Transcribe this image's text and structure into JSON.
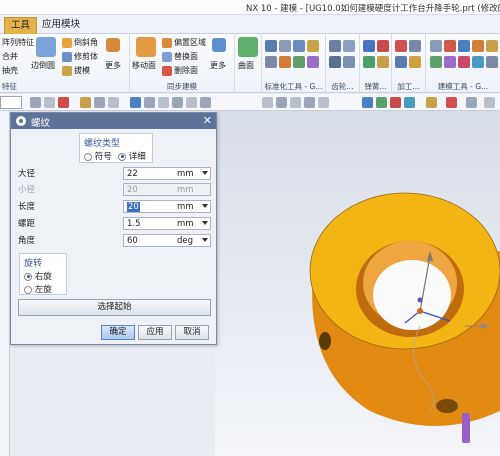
{
  "window": {
    "title": "NX 10 - 建模 - [UG10.0如何建模硬度计工作台升降手轮.prt  (修改的) ]"
  },
  "ribbon": {
    "tabs": [
      "工具",
      "应用模块"
    ],
    "groups": [
      {
        "label": "特征",
        "items": [
          "阵列特征",
          "合并",
          "抽壳",
          "边倒圆",
          "倒斜角",
          "修剪体",
          "拔模",
          "更多"
        ]
      },
      {
        "label": "同步建模",
        "items": [
          "移动面",
          "偏置区域",
          "替换面",
          "删除面",
          "更多"
        ]
      },
      {
        "label": "曲面",
        "items": [
          "曲面"
        ]
      },
      {
        "label": "标准化工具 - G...",
        "items": []
      },
      {
        "label": "齿轮...",
        "items": []
      },
      {
        "label": "弹簧...",
        "items": []
      },
      {
        "label": "加工...",
        "items": []
      },
      {
        "label": "建模工具 - G...",
        "items": []
      }
    ]
  },
  "dialog": {
    "title": "螺纹",
    "thread_type": {
      "header": "螺纹类型",
      "options": [
        "符号",
        "详细"
      ],
      "selected": "详细"
    },
    "fields": [
      {
        "label": "大径",
        "value": "22",
        "unit": "mm",
        "enabled": true
      },
      {
        "label": "小径",
        "value": "20",
        "unit": "mm",
        "enabled": false
      },
      {
        "label": "长度",
        "value": "20",
        "unit": "mm",
        "enabled": true
      },
      {
        "label": "螺距",
        "value": "1.5",
        "unit": "mm",
        "enabled": true
      },
      {
        "label": "角度",
        "value": "60",
        "unit": "deg",
        "enabled": true
      }
    ],
    "rotation": {
      "header": "旋转",
      "options": [
        "右旋",
        "左旋"
      ],
      "selected": "右旋"
    },
    "select_start": "选择起始",
    "buttons": {
      "ok": "确定",
      "apply": "应用",
      "cancel": "取消"
    }
  },
  "colors": {
    "ribbon_active_tab": "#e3b34b",
    "dialog_header": "#5d7399",
    "model_yellow": "#f1b613",
    "model_orange": "#e07a10"
  }
}
